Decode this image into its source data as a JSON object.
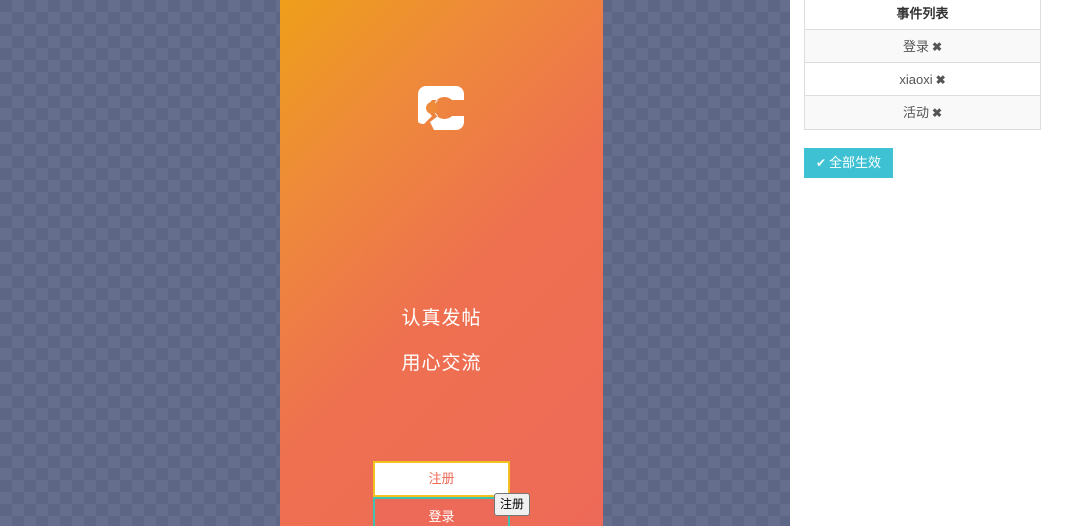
{
  "phone": {
    "slogan_line1": "认真发帖",
    "slogan_line2": "用心交流",
    "register_label": "注册",
    "login_label": "登录",
    "tooltip_text": "注册"
  },
  "event_list": {
    "header": "事件列表",
    "items": [
      {
        "label": "登录"
      },
      {
        "label": "xiaoxi"
      },
      {
        "label": "活动"
      }
    ]
  },
  "apply_all_label": "全部生效",
  "icons": {
    "logo": "chat-logo-icon",
    "remove": "close-icon",
    "check": "check-icon"
  },
  "colors": {
    "gradient_start": "#ee9f1a",
    "gradient_end": "#ee6a58",
    "canvas_bg": "#5d6685",
    "accent": "#3dc1d3"
  }
}
